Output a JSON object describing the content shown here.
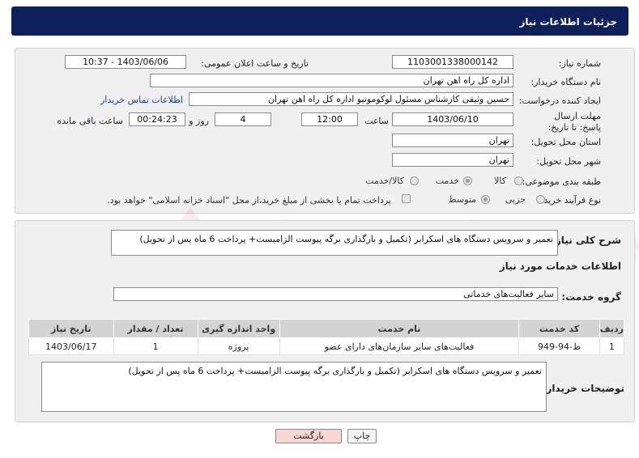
{
  "header": {
    "title": "جزئیات اطلاعات نیاز"
  },
  "form": {
    "need_number_label": "شماره نیاز:",
    "need_number": "1103001338000142",
    "announce_label": "تاریخ و ساعت اعلان عمومی:",
    "announce_value": "1403/06/06 - 10:37",
    "buyer_org_label": "نام دستگاه خریدار:",
    "buyer_org": "اداره کل راه اهن تهران",
    "creator_label": "ایجاد کننده درخواست:",
    "creator": "حسین وثیقی کارشناس مسئول لوکوموتیو اداره کل راه اهن تهران",
    "contact_link": "اطلاعات تماس خریدار",
    "deadline_label": "مهلت ارسال پاسخ: تا تاریخ:",
    "deadline_date": "1403/06/10",
    "time_label": "ساعت",
    "deadline_time": "12:00",
    "days_value": "4",
    "days_label": "روز و",
    "remaining_time": "00:24:23",
    "remaining_label": "ساعت باقی مانده",
    "province_label": "استان محل تحویل:",
    "province": "تهران",
    "city_label": "شهر محل تحویل:",
    "city": "تهران",
    "category_label": "طبقه بندی موضوعی:",
    "category_options": [
      "کالا",
      "خدمت",
      "کالا/خدمت"
    ],
    "purchase_type_label": "نوع فرآیند خرید :",
    "purchase_type_options": [
      "جزیی",
      "متوسط"
    ],
    "payment_note": "پرداخت تمام یا بخشی از مبلغ خرید،از محل \"اسناد خزانه اسلامی\" خواهد بود."
  },
  "details": {
    "summary_label": "شرح کلی نیاز:",
    "summary": "تعمیر و سرویس دستگاه های اسکرابر (تکمیل و بارگذاری برگه پیوست الزامیست+ پرداخت 6 ماه پس از تحویل)",
    "services_title": "اطلاعات خدمات مورد نیاز",
    "service_group_label": "گروه خدمت:",
    "service_group": "سایر فعالیت‌های خدماتی",
    "table": {
      "headers": [
        "ردیف",
        "کد خدمت",
        "نام خدمت",
        "واحد اندازه گیری",
        "تعداد / مقدار",
        "تاریخ نیاز"
      ],
      "rows": [
        [
          "1",
          "ط-94-949",
          "فعالیت‌های سایر سازمان‌های دارای عضو",
          "پروژه",
          "1",
          "1403/06/17"
        ]
      ]
    },
    "buyer_notes_label": "توضیحات خریدار:",
    "buyer_notes": "تعمیر و سرویس دستگاه های اسکرابر (تکمیل و بارگذاری برگه پیوست الزامیست+ پرداخت 6 ماه پس از تحویل)"
  },
  "buttons": {
    "print": "چاپ",
    "back": "بازگشت"
  },
  "watermark": {
    "text": "AriaTender.net"
  },
  "colors": {
    "header_bg": "#0f1f5c",
    "link": "#1a3d9c",
    "back_button_bg": "#f7d6d6"
  }
}
